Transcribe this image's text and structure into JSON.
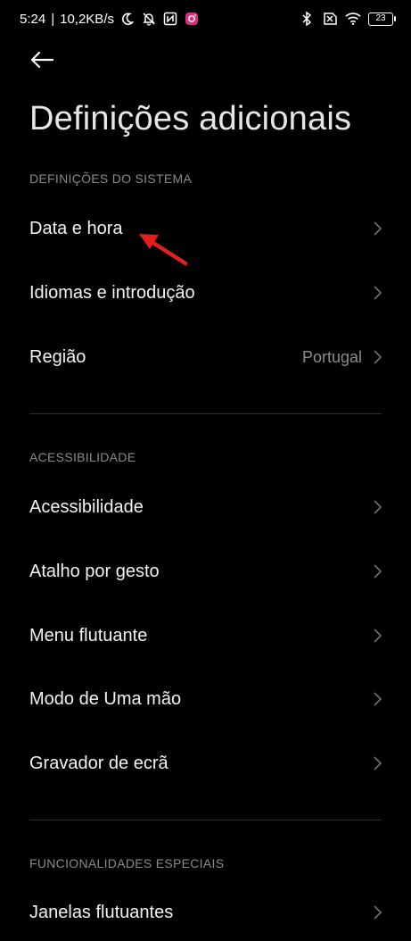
{
  "status_bar": {
    "time": "5:24",
    "separator": "|",
    "speed": "10,2KB/s",
    "icons_left": [
      "moon-icon",
      "bell-off-icon",
      "nfc-icon",
      "instagram-icon"
    ],
    "icons_right": [
      "bluetooth-icon",
      "no-sim-icon",
      "wifi-icon"
    ],
    "battery": "23"
  },
  "header": {
    "back_icon": "arrow-left-icon",
    "title": "Definições adicionais"
  },
  "sections": [
    {
      "header": "DEFINIÇÕES DO SISTEMA",
      "items": [
        {
          "label": "Data e hora",
          "value": ""
        },
        {
          "label": "Idiomas e introdução",
          "value": ""
        },
        {
          "label": "Região",
          "value": "Portugal"
        }
      ]
    },
    {
      "header": "ACESSIBILIDADE",
      "items": [
        {
          "label": "Acessibilidade",
          "value": ""
        },
        {
          "label": "Atalho por gesto",
          "value": ""
        },
        {
          "label": "Menu flutuante",
          "value": ""
        },
        {
          "label": "Modo de Uma mão",
          "value": ""
        },
        {
          "label": "Gravador de ecrã",
          "value": ""
        }
      ]
    },
    {
      "header": "FUNCIONALIDADES ESPECIAIS",
      "items": [
        {
          "label": "Janelas flutuantes",
          "value": ""
        }
      ]
    }
  ],
  "colors": {
    "background": "#000000",
    "text_primary": "#f2f2f2",
    "text_secondary": "#8a8a8a",
    "annotation_arrow": "#e0201f"
  }
}
